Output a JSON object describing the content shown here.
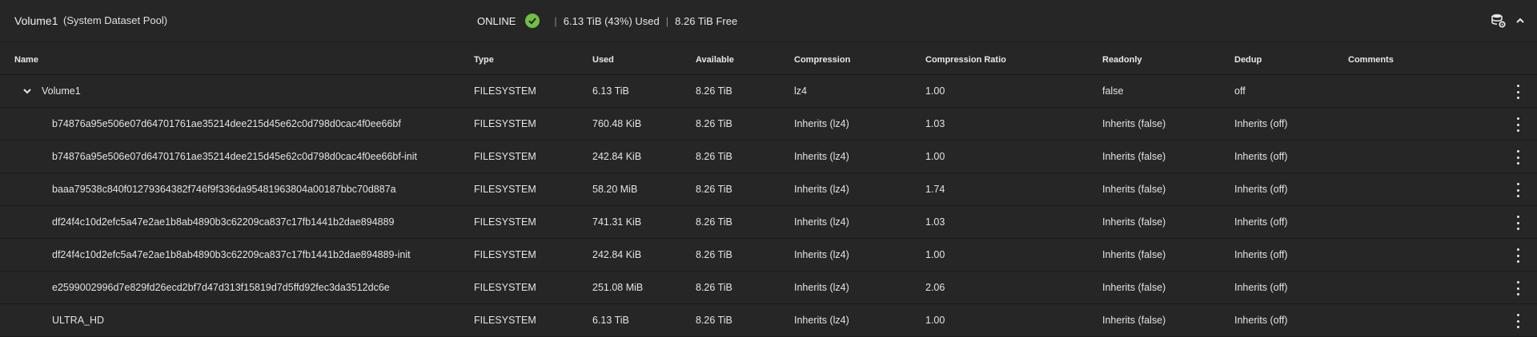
{
  "pool": {
    "name": "Volume1",
    "subtitle": "(System Dataset Pool)",
    "status": "ONLINE",
    "used": "6.13 TiB (43%) Used",
    "free": "8.26 TiB Free",
    "status_color": "#71bf44"
  },
  "columns": {
    "name": "Name",
    "type": "Type",
    "used": "Used",
    "available": "Available",
    "compression": "Compression",
    "ratio": "Compression Ratio",
    "readonly": "Readonly",
    "dedup": "Dedup",
    "comments": "Comments"
  },
  "rows": [
    {
      "name": "Volume1",
      "type": "FILESYSTEM",
      "used": "6.13 TiB",
      "available": "8.26 TiB",
      "compression": "lz4",
      "ratio": "1.00",
      "readonly": "false",
      "dedup": "off",
      "comments": ""
    },
    {
      "name": "b74876a95e506e07d64701761ae35214dee215d45e62c0d798d0cac4f0ee66bf",
      "type": "FILESYSTEM",
      "used": "760.48 KiB",
      "available": "8.26 TiB",
      "compression": "Inherits (lz4)",
      "ratio": "1.03",
      "readonly": "Inherits (false)",
      "dedup": "Inherits (off)",
      "comments": ""
    },
    {
      "name": "b74876a95e506e07d64701761ae35214dee215d45e62c0d798d0cac4f0ee66bf-init",
      "type": "FILESYSTEM",
      "used": "242.84 KiB",
      "available": "8.26 TiB",
      "compression": "Inherits (lz4)",
      "ratio": "1.00",
      "readonly": "Inherits (false)",
      "dedup": "Inherits (off)",
      "comments": ""
    },
    {
      "name": "baaa79538c840f01279364382f746f9f336da95481963804a00187bbc70d887a",
      "type": "FILESYSTEM",
      "used": "58.20 MiB",
      "available": "8.26 TiB",
      "compression": "Inherits (lz4)",
      "ratio": "1.74",
      "readonly": "Inherits (false)",
      "dedup": "Inherits (off)",
      "comments": ""
    },
    {
      "name": "df24f4c10d2efc5a47e2ae1b8ab4890b3c62209ca837c17fb1441b2dae894889",
      "type": "FILESYSTEM",
      "used": "741.31 KiB",
      "available": "8.26 TiB",
      "compression": "Inherits (lz4)",
      "ratio": "1.03",
      "readonly": "Inherits (false)",
      "dedup": "Inherits (off)",
      "comments": ""
    },
    {
      "name": "df24f4c10d2efc5a47e2ae1b8ab4890b3c62209ca837c17fb1441b2dae894889-init",
      "type": "FILESYSTEM",
      "used": "242.84 KiB",
      "available": "8.26 TiB",
      "compression": "Inherits (lz4)",
      "ratio": "1.00",
      "readonly": "Inherits (false)",
      "dedup": "Inherits (off)",
      "comments": ""
    },
    {
      "name": "e2599002996d7e829fd26ecd2bf7d47d313f15819d7d5ffd92fec3da3512dc6e",
      "type": "FILESYSTEM",
      "used": "251.08 MiB",
      "available": "8.26 TiB",
      "compression": "Inherits (lz4)",
      "ratio": "2.06",
      "readonly": "Inherits (false)",
      "dedup": "Inherits (off)",
      "comments": ""
    },
    {
      "name": "ULTRA_HD",
      "type": "FILESYSTEM",
      "used": "6.13 TiB",
      "available": "8.26 TiB",
      "compression": "Inherits (lz4)",
      "ratio": "1.00",
      "readonly": "Inherits (false)",
      "dedup": "Inherits (off)",
      "comments": ""
    }
  ],
  "icons": {
    "status": "check-circle-icon",
    "pool_actions": "database-gear-icon",
    "collapse": "chevron-up-icon",
    "expand": "chevron-down-icon",
    "row_menu": "more-vert-icon"
  }
}
